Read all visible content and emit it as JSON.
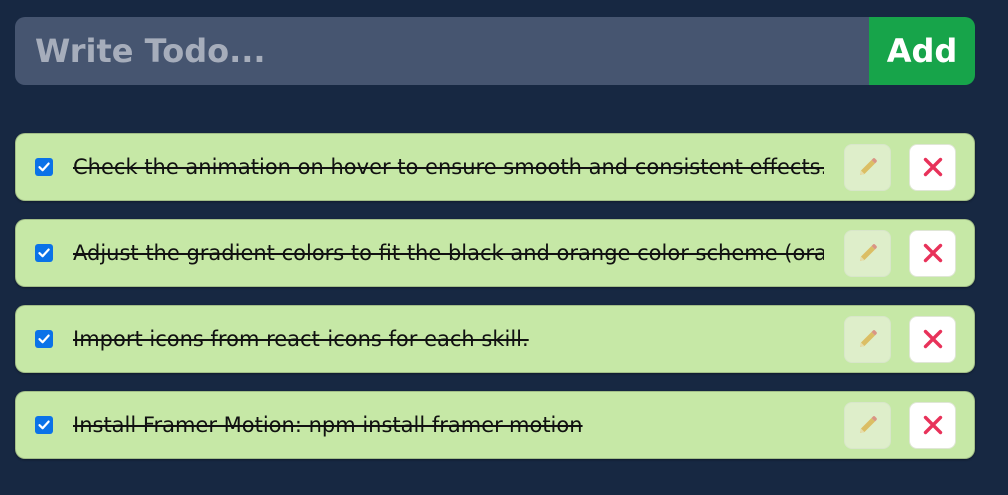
{
  "input": {
    "placeholder": "Write Todo...",
    "value": ""
  },
  "add_button": {
    "label": "Add",
    "color": "#17a44a"
  },
  "item_background": "#c6e8a6",
  "todos": [
    {
      "text": "Check the animation on hover to ensure smooth and consistent effects.",
      "completed": true
    },
    {
      "text": "Adjust the gradient colors to fit the black and orange color scheme (orange",
      "completed": true
    },
    {
      "text": "Import icons from react-icons for each skill.",
      "completed": true
    },
    {
      "text": "Install Framer Motion: npm install framer-motion",
      "completed": true
    }
  ],
  "icons": {
    "checkbox": "checkbox-checked-icon",
    "edit": "pencil-icon",
    "delete": "x-icon"
  }
}
